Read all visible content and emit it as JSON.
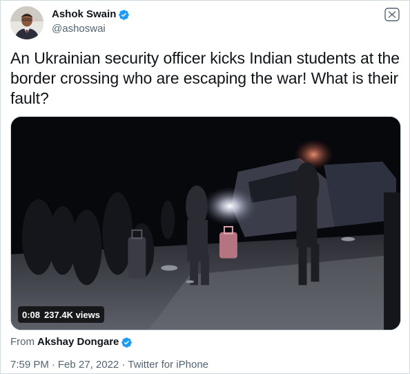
{
  "author": {
    "name": "Ashok Swain",
    "handle": "@ashoswai",
    "verified": true
  },
  "tweet": {
    "text": "An Ukrainian security officer kicks Indian students at the border crossing who are escaping the war! What is their fault?"
  },
  "video": {
    "duration": "0:08",
    "views": "237.4K views"
  },
  "source": {
    "prefix": "From",
    "name": "Akshay Dongare",
    "verified": true
  },
  "meta": {
    "time": "7:59 PM",
    "separator": "·",
    "date": "Feb 27, 2022",
    "client": "Twitter for iPhone"
  },
  "colors": {
    "verified_blue": "#1d9bf0",
    "text_primary": "#0f1419",
    "text_secondary": "#536471",
    "border": "#cfd9de"
  },
  "icons": {
    "verified": "verified-badge-icon",
    "more": "more-options-icon"
  }
}
